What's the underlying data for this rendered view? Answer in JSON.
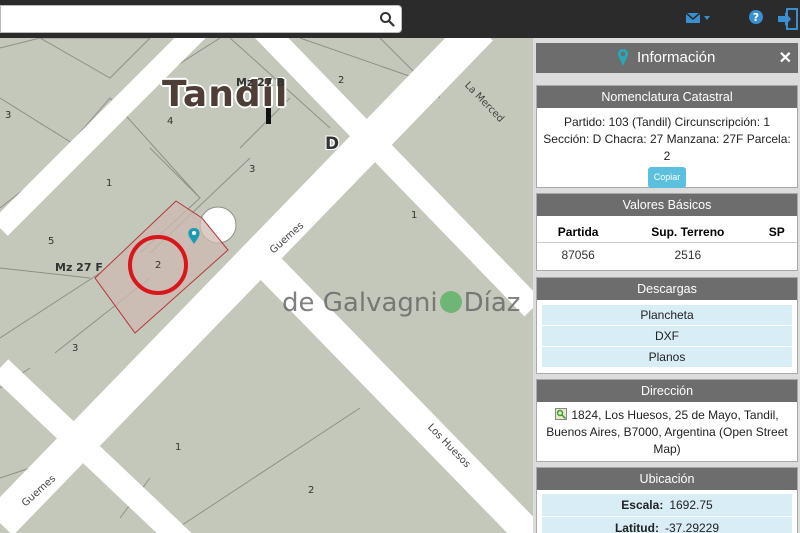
{
  "search": {
    "placeholder": ""
  },
  "map": {
    "city_label": "Tandil",
    "manzana_labels": {
      "mz27b": "Mz 27 B",
      "mz27f": "Mz 27 F"
    },
    "section_letter": "D",
    "chacra_marker": "I",
    "parcel_numbers": [
      "2",
      "3",
      "4",
      "1",
      "5",
      "2",
      "3",
      "1",
      "1",
      "2",
      "3"
    ],
    "streets": {
      "guemes_1": "Guemes",
      "guemes_2": "Guemes",
      "la_merced": "La Merced",
      "los_huesos": "Los Huesos"
    },
    "watermark": {
      "part1": "de Galvagni",
      "part2": "Díaz"
    }
  },
  "panel": {
    "title": "Información",
    "close": "✕",
    "nomenclatura": {
      "header": "Nomenclatura Catastral",
      "line1": "Partido: 103 (Tandil) Circunscripción: 1",
      "line2": "Sección: D Chacra: 27 Manzana: 27F Parcela:",
      "line3": "2",
      "copy_button": "Copiar"
    },
    "valores": {
      "header": "Valores Básicos",
      "columns": [
        "Partida",
        "Sup. Terreno",
        "SP"
      ],
      "row": [
        "87056",
        "2516",
        ""
      ]
    },
    "descargas": {
      "header": "Descargas",
      "items": [
        "Plancheta",
        "DXF",
        "Planos"
      ]
    },
    "direccion": {
      "header": "Dirección",
      "line1": "1824, Los Huesos, 25 de Mayo, Tandil,",
      "line2": "Buenos Aires, B7000, Argentina (Open Street",
      "line3": "Map)"
    },
    "ubicacion": {
      "header": "Ubicación",
      "escala_label": "Escala:",
      "escala_value": "1692.75",
      "latitud_label": "Latitud:",
      "latitud_value": "-37.29229"
    }
  },
  "colors": {
    "topbar": "#2b2b2b",
    "panel_header": "#6d6d6d",
    "accent": "#2aa6b5",
    "highlight_circle": "#d9161c"
  }
}
